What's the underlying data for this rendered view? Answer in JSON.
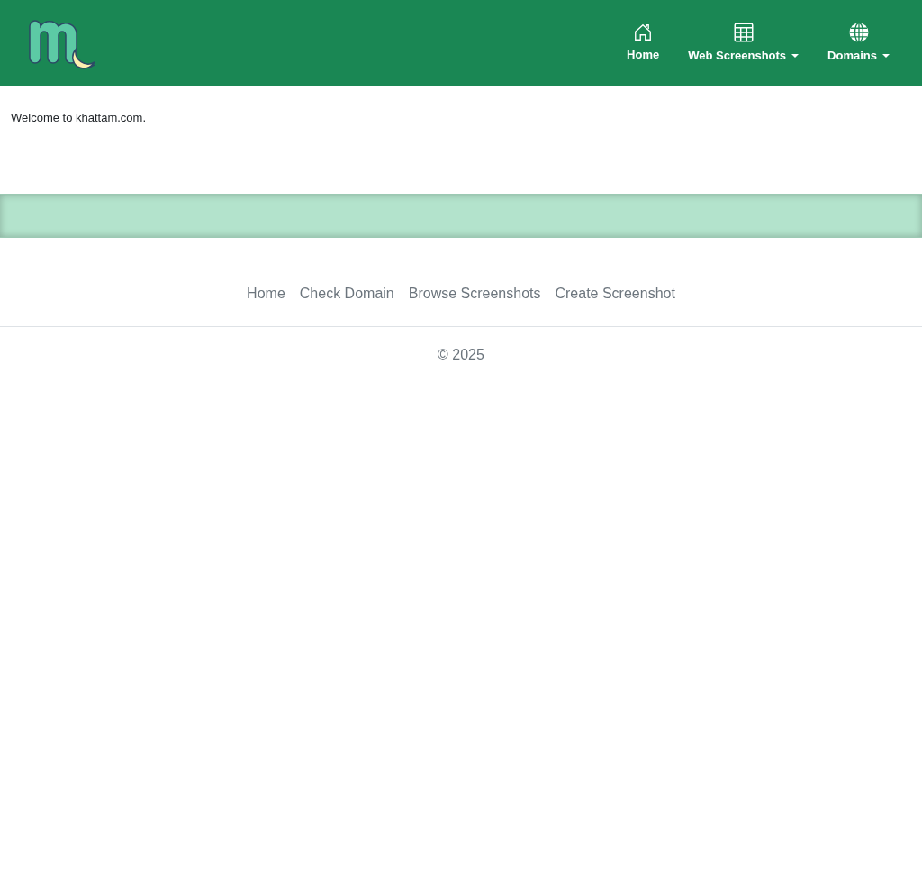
{
  "navbar": {
    "items": [
      {
        "label": "Home",
        "kind": "home",
        "dropdown": false
      },
      {
        "label": "Web Screenshots",
        "kind": "table",
        "dropdown": true
      },
      {
        "label": "Domains",
        "kind": "globe",
        "dropdown": true
      }
    ]
  },
  "main": {
    "text": "Welcome to khattam.com."
  },
  "footer": {
    "links": [
      "Home",
      "Check Domain",
      "Browse Screenshots",
      "Create Screenshot"
    ],
    "copyright": "© 2025"
  }
}
